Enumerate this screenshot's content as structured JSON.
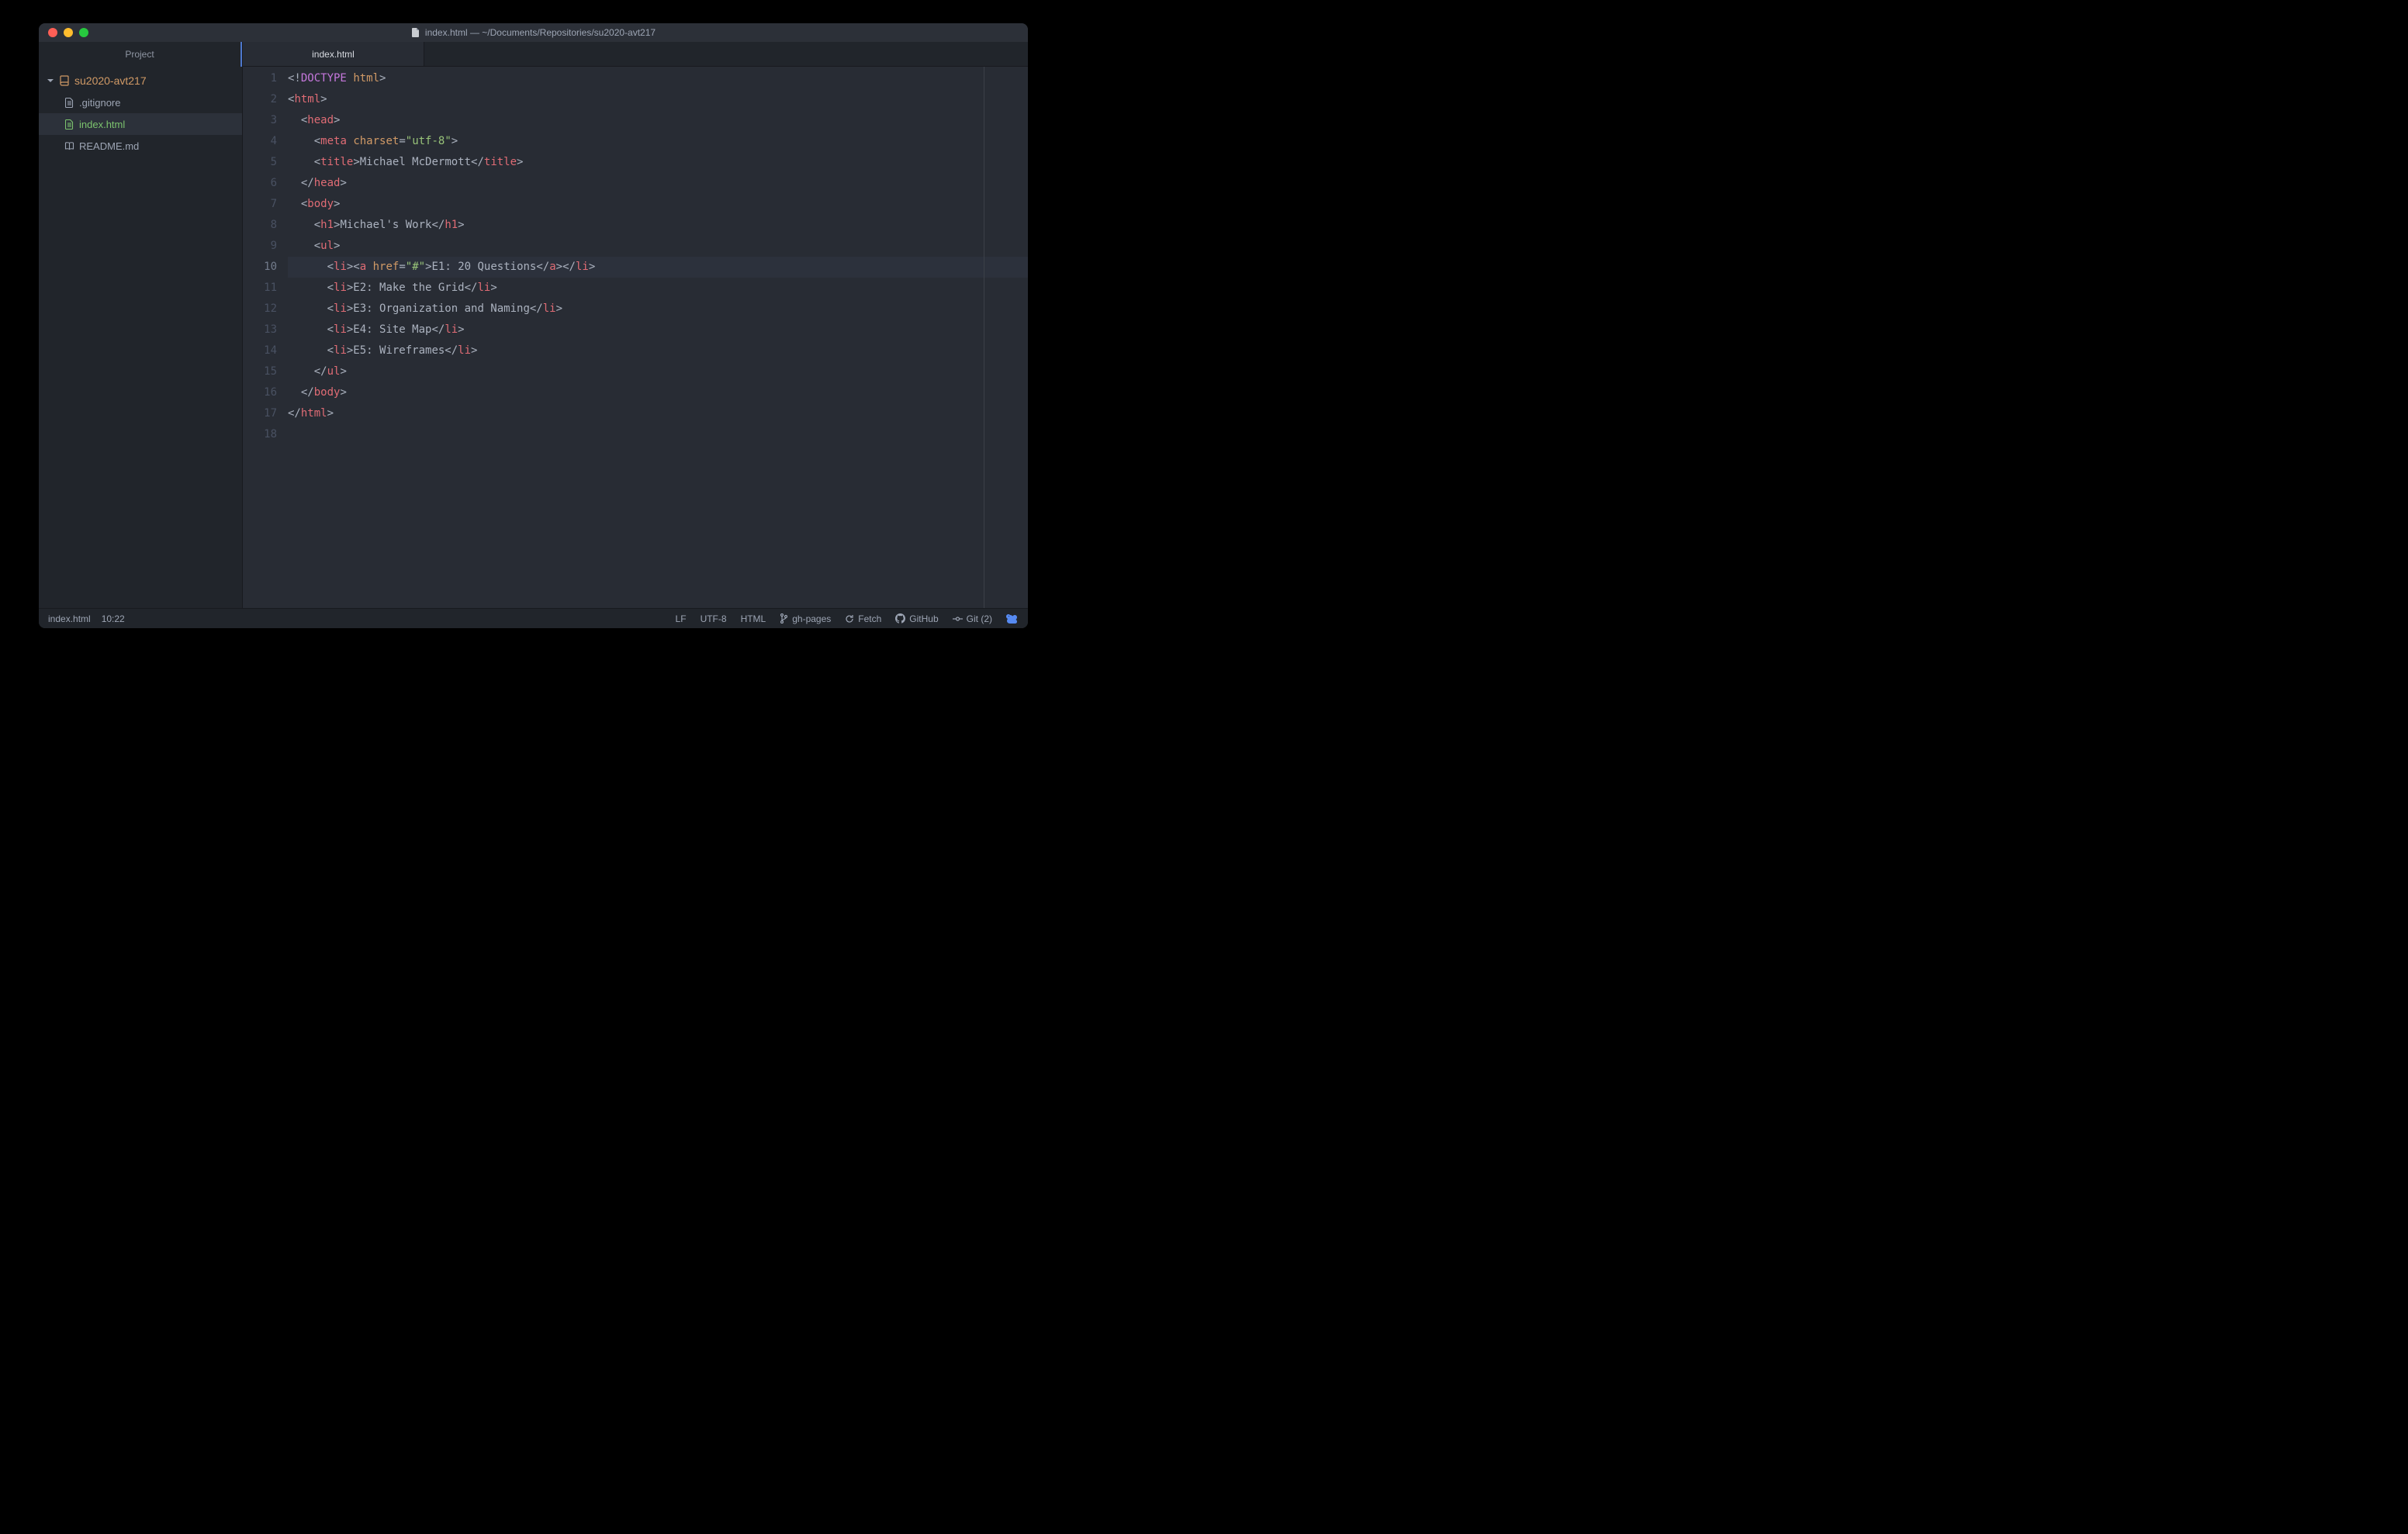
{
  "titlebar": {
    "title": "index.html — ~/Documents/Repositories/su2020-avt217"
  },
  "sidebar": {
    "header": "Project",
    "root": "su2020-avt217",
    "files": [
      {
        "name": ".gitignore",
        "icon": "file",
        "active": false,
        "color": "default"
      },
      {
        "name": "index.html",
        "icon": "file",
        "active": true,
        "color": "green"
      },
      {
        "name": "README.md",
        "icon": "book",
        "active": false,
        "color": "default"
      }
    ]
  },
  "tabs": {
    "active": "index.html"
  },
  "editor": {
    "highlightLine": 10,
    "lines": [
      {
        "n": 1,
        "tokens": [
          [
            "p-gray",
            "<!"
          ],
          [
            "p-kw",
            "DOCTYPE"
          ],
          [
            "p-gray",
            " "
          ],
          [
            "p-attr",
            "html"
          ],
          [
            "p-gray",
            ">"
          ]
        ]
      },
      {
        "n": 2,
        "tokens": [
          [
            "p-gray",
            "<"
          ],
          [
            "p-tag",
            "html"
          ],
          [
            "p-gray",
            ">"
          ]
        ]
      },
      {
        "n": 3,
        "tokens": [
          [
            "p-gray",
            "  <"
          ],
          [
            "p-tag",
            "head"
          ],
          [
            "p-gray",
            ">"
          ]
        ]
      },
      {
        "n": 4,
        "tokens": [
          [
            "p-gray",
            "    <"
          ],
          [
            "p-tag",
            "meta"
          ],
          [
            "p-gray",
            " "
          ],
          [
            "p-attr",
            "charset"
          ],
          [
            "p-gray",
            "="
          ],
          [
            "p-str",
            "\"utf-8\""
          ],
          [
            "p-gray",
            ">"
          ]
        ]
      },
      {
        "n": 5,
        "tokens": [
          [
            "p-gray",
            "    <"
          ],
          [
            "p-tag",
            "title"
          ],
          [
            "p-gray",
            ">Michael McDermott</"
          ],
          [
            "p-tag",
            "title"
          ],
          [
            "p-gray",
            ">"
          ]
        ]
      },
      {
        "n": 6,
        "tokens": [
          [
            "p-gray",
            "  </"
          ],
          [
            "p-tag",
            "head"
          ],
          [
            "p-gray",
            ">"
          ]
        ]
      },
      {
        "n": 7,
        "tokens": [
          [
            "p-gray",
            "  <"
          ],
          [
            "p-tag",
            "body"
          ],
          [
            "p-gray",
            ">"
          ]
        ]
      },
      {
        "n": 8,
        "tokens": [
          [
            "p-gray",
            "    <"
          ],
          [
            "p-tag",
            "h1"
          ],
          [
            "p-gray",
            ">Michael's Work</"
          ],
          [
            "p-tag",
            "h1"
          ],
          [
            "p-gray",
            ">"
          ]
        ]
      },
      {
        "n": 9,
        "tokens": [
          [
            "p-gray",
            "    <"
          ],
          [
            "p-tag",
            "ul"
          ],
          [
            "p-gray",
            ">"
          ]
        ]
      },
      {
        "n": 10,
        "tokens": [
          [
            "p-gray",
            "      <"
          ],
          [
            "p-tag",
            "li"
          ],
          [
            "p-gray",
            "><"
          ],
          [
            "p-tag",
            "a"
          ],
          [
            "p-gray",
            " "
          ],
          [
            "p-attr",
            "href"
          ],
          [
            "p-gray",
            "="
          ],
          [
            "p-str",
            "\"#\""
          ],
          [
            "p-gray",
            ">E1: 20 Questions</"
          ],
          [
            "p-tag",
            "a"
          ],
          [
            "p-gray",
            "></"
          ],
          [
            "p-tag",
            "li"
          ],
          [
            "p-gray",
            ">"
          ]
        ]
      },
      {
        "n": 11,
        "tokens": [
          [
            "p-gray",
            "      <"
          ],
          [
            "p-tag",
            "li"
          ],
          [
            "p-gray",
            ">E2: Make the Grid</"
          ],
          [
            "p-tag",
            "li"
          ],
          [
            "p-gray",
            ">"
          ]
        ]
      },
      {
        "n": 12,
        "tokens": [
          [
            "p-gray",
            "      <"
          ],
          [
            "p-tag",
            "li"
          ],
          [
            "p-gray",
            ">E3: Organization and Naming</"
          ],
          [
            "p-tag",
            "li"
          ],
          [
            "p-gray",
            ">"
          ]
        ]
      },
      {
        "n": 13,
        "tokens": [
          [
            "p-gray",
            "      <"
          ],
          [
            "p-tag",
            "li"
          ],
          [
            "p-gray",
            ">E4: Site Map</"
          ],
          [
            "p-tag",
            "li"
          ],
          [
            "p-gray",
            ">"
          ]
        ]
      },
      {
        "n": 14,
        "tokens": [
          [
            "p-gray",
            "      <"
          ],
          [
            "p-tag",
            "li"
          ],
          [
            "p-gray",
            ">E5: Wireframes</"
          ],
          [
            "p-tag",
            "li"
          ],
          [
            "p-gray",
            ">"
          ]
        ]
      },
      {
        "n": 15,
        "tokens": [
          [
            "p-gray",
            "    </"
          ],
          [
            "p-tag",
            "ul"
          ],
          [
            "p-gray",
            ">"
          ]
        ]
      },
      {
        "n": 16,
        "tokens": [
          [
            "p-gray",
            "  </"
          ],
          [
            "p-tag",
            "body"
          ],
          [
            "p-gray",
            ">"
          ]
        ]
      },
      {
        "n": 17,
        "tokens": [
          [
            "p-gray",
            "</"
          ],
          [
            "p-tag",
            "html"
          ],
          [
            "p-gray",
            ">"
          ]
        ]
      },
      {
        "n": 18,
        "tokens": []
      }
    ]
  },
  "statusbar": {
    "file": "index.html",
    "cursor": "10:22",
    "lineEnding": "LF",
    "encoding": "UTF-8",
    "language": "HTML",
    "branch": "gh-pages",
    "fetch": "Fetch",
    "github": "GitHub",
    "git": "Git (2)"
  }
}
